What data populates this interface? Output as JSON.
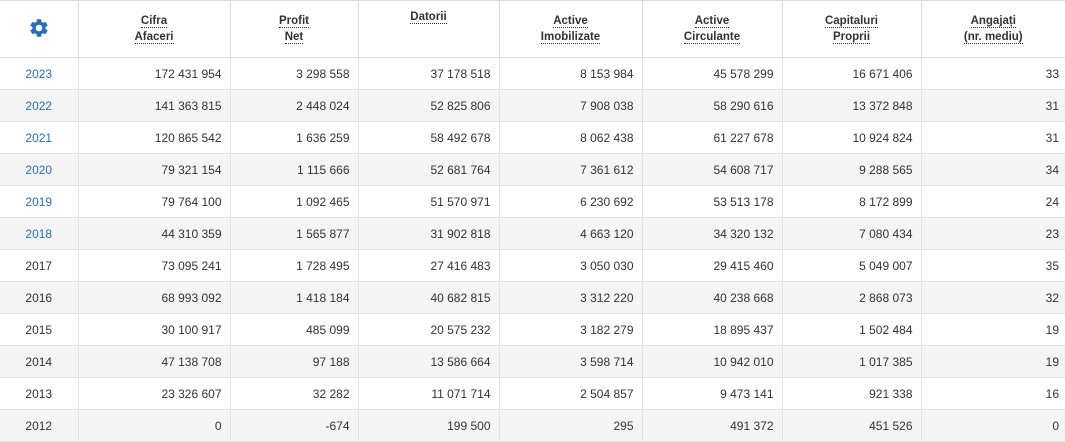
{
  "header": {
    "settings_icon": "gear-icon",
    "columns": [
      {
        "line1": "Cifra",
        "line2": "Afaceri"
      },
      {
        "line1": "Profit",
        "line2": "Net"
      },
      {
        "line1": "Datorii",
        "line2": ""
      },
      {
        "line1": "Active",
        "line2": "Imobilizate"
      },
      {
        "line1": "Active",
        "line2": "Circulante"
      },
      {
        "line1": "Capitaluri",
        "line2": "Proprii"
      },
      {
        "line1": "Angajați",
        "line2": "(nr. mediu)"
      }
    ]
  },
  "colors": {
    "accent": "#2a6eb5",
    "row_alt": "#f5f5f5",
    "border": "#dddddd"
  },
  "rows": [
    {
      "year": "2023",
      "linked": true,
      "values": [
        "172 431 954",
        "3 298 558",
        "37 178 518",
        "8 153 984",
        "45 578 299",
        "16 671 406",
        "33"
      ]
    },
    {
      "year": "2022",
      "linked": true,
      "values": [
        "141 363 815",
        "2 448 024",
        "52 825 806",
        "7 908 038",
        "58 290 616",
        "13 372 848",
        "31"
      ]
    },
    {
      "year": "2021",
      "linked": true,
      "values": [
        "120 865 542",
        "1 636 259",
        "58 492 678",
        "8 062 438",
        "61 227 678",
        "10 924 824",
        "31"
      ]
    },
    {
      "year": "2020",
      "linked": true,
      "values": [
        "79 321 154",
        "1 115 666",
        "52 681 764",
        "7 361 612",
        "54 608 717",
        "9 288 565",
        "34"
      ]
    },
    {
      "year": "2019",
      "linked": true,
      "values": [
        "79 764 100",
        "1 092 465",
        "51 570 971",
        "6 230 692",
        "53 513 178",
        "8 172 899",
        "24"
      ]
    },
    {
      "year": "2018",
      "linked": true,
      "values": [
        "44 310 359",
        "1 565 877",
        "31 902 818",
        "4 663 120",
        "34 320 132",
        "7 080 434",
        "23"
      ]
    },
    {
      "year": "2017",
      "linked": false,
      "values": [
        "73 095 241",
        "1 728 495",
        "27 416 483",
        "3 050 030",
        "29 415 460",
        "5 049 007",
        "35"
      ]
    },
    {
      "year": "2016",
      "linked": false,
      "values": [
        "68 993 092",
        "1 418 184",
        "40 682 815",
        "3 312 220",
        "40 238 668",
        "2 868 073",
        "32"
      ]
    },
    {
      "year": "2015",
      "linked": false,
      "values": [
        "30 100 917",
        "485 099",
        "20 575 232",
        "3 182 279",
        "18 895 437",
        "1 502 484",
        "19"
      ]
    },
    {
      "year": "2014",
      "linked": false,
      "values": [
        "47 138 708",
        "97 188",
        "13 586 664",
        "3 598 714",
        "10 942 010",
        "1 017 385",
        "19"
      ]
    },
    {
      "year": "2013",
      "linked": false,
      "values": [
        "23 326 607",
        "32 282",
        "11 071 714",
        "2 504 857",
        "9 473 141",
        "921 338",
        "16"
      ]
    },
    {
      "year": "2012",
      "linked": false,
      "values": [
        "0",
        "-674",
        "199 500",
        "295",
        "491 372",
        "451 526",
        "0"
      ]
    }
  ]
}
